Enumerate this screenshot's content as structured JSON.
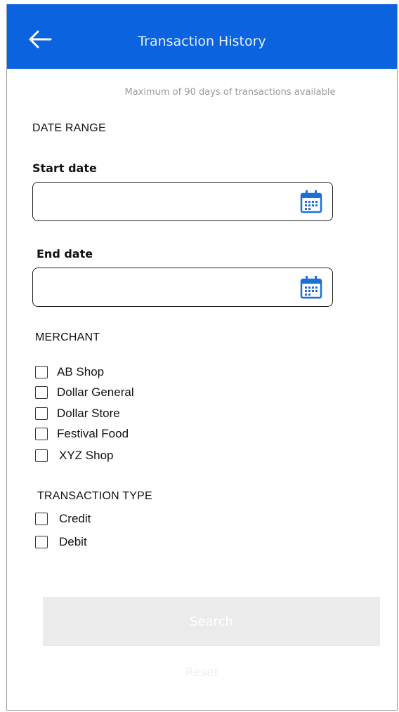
{
  "header": {
    "title": "Transaction History",
    "back_icon": "arrow-left-icon"
  },
  "notice": "Maximum of 90 days of transactions available",
  "date_range": {
    "heading": "DATE RANGE",
    "start": {
      "label": "Start date",
      "value": "",
      "icon": "calendar-icon"
    },
    "end": {
      "label": "End date",
      "value": "",
      "icon": "calendar-icon"
    }
  },
  "merchant": {
    "heading": "MERCHANT",
    "options": [
      {
        "label": "AB Shop",
        "checked": false
      },
      {
        "label": "Dollar General",
        "checked": false
      },
      {
        "label": "Dollar Store",
        "checked": false
      },
      {
        "label": "Festival Food",
        "checked": false
      },
      {
        "label": "XYZ Shop",
        "checked": false
      }
    ]
  },
  "transaction_type": {
    "heading": "TRANSACTION TYPE",
    "options": [
      {
        "label": "Credit",
        "checked": false
      },
      {
        "label": "Debit",
        "checked": false
      }
    ]
  },
  "actions": {
    "search_label": "Search",
    "reset_label": "Reset"
  },
  "colors": {
    "header_bg": "#0b63df",
    "calendar_icon": "#1c6fd8",
    "disabled_button": "#ebebeb"
  }
}
